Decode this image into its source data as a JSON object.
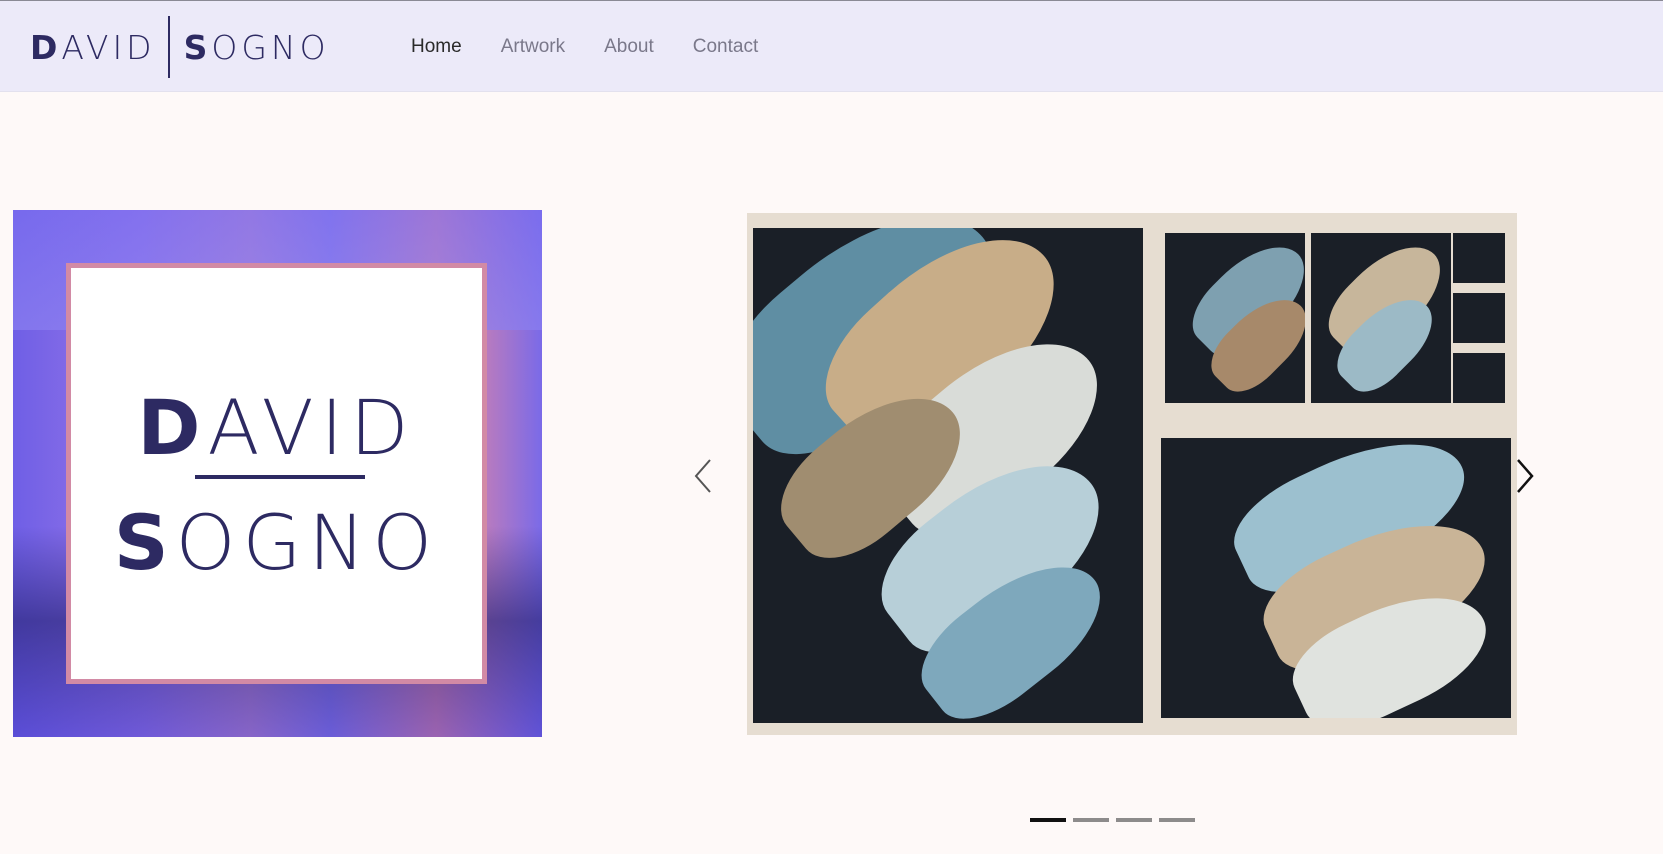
{
  "brand": {
    "first_initial": "D",
    "first_rest": "AVID",
    "last_initial": "S",
    "last_rest": "OGNO"
  },
  "nav": {
    "items": [
      {
        "label": "Home",
        "active": true
      },
      {
        "label": "Artwork",
        "active": false
      },
      {
        "label": "About",
        "active": false
      },
      {
        "label": "Contact",
        "active": false
      }
    ]
  },
  "hero_logo": {
    "first_initial": "D",
    "first_rest": "AVID",
    "last_initial": "S",
    "last_rest": "OGNO"
  },
  "carousel": {
    "prev_icon": "chevron-left-icon",
    "next_icon": "chevron-right-icon",
    "slide_count": 4,
    "active_index": 0
  },
  "colors": {
    "navbar_bg": "#eceaf9",
    "page_bg": "#fef9f8",
    "brand_navy": "#2d2a62",
    "logo_frame_pink": "#d28aa5"
  }
}
